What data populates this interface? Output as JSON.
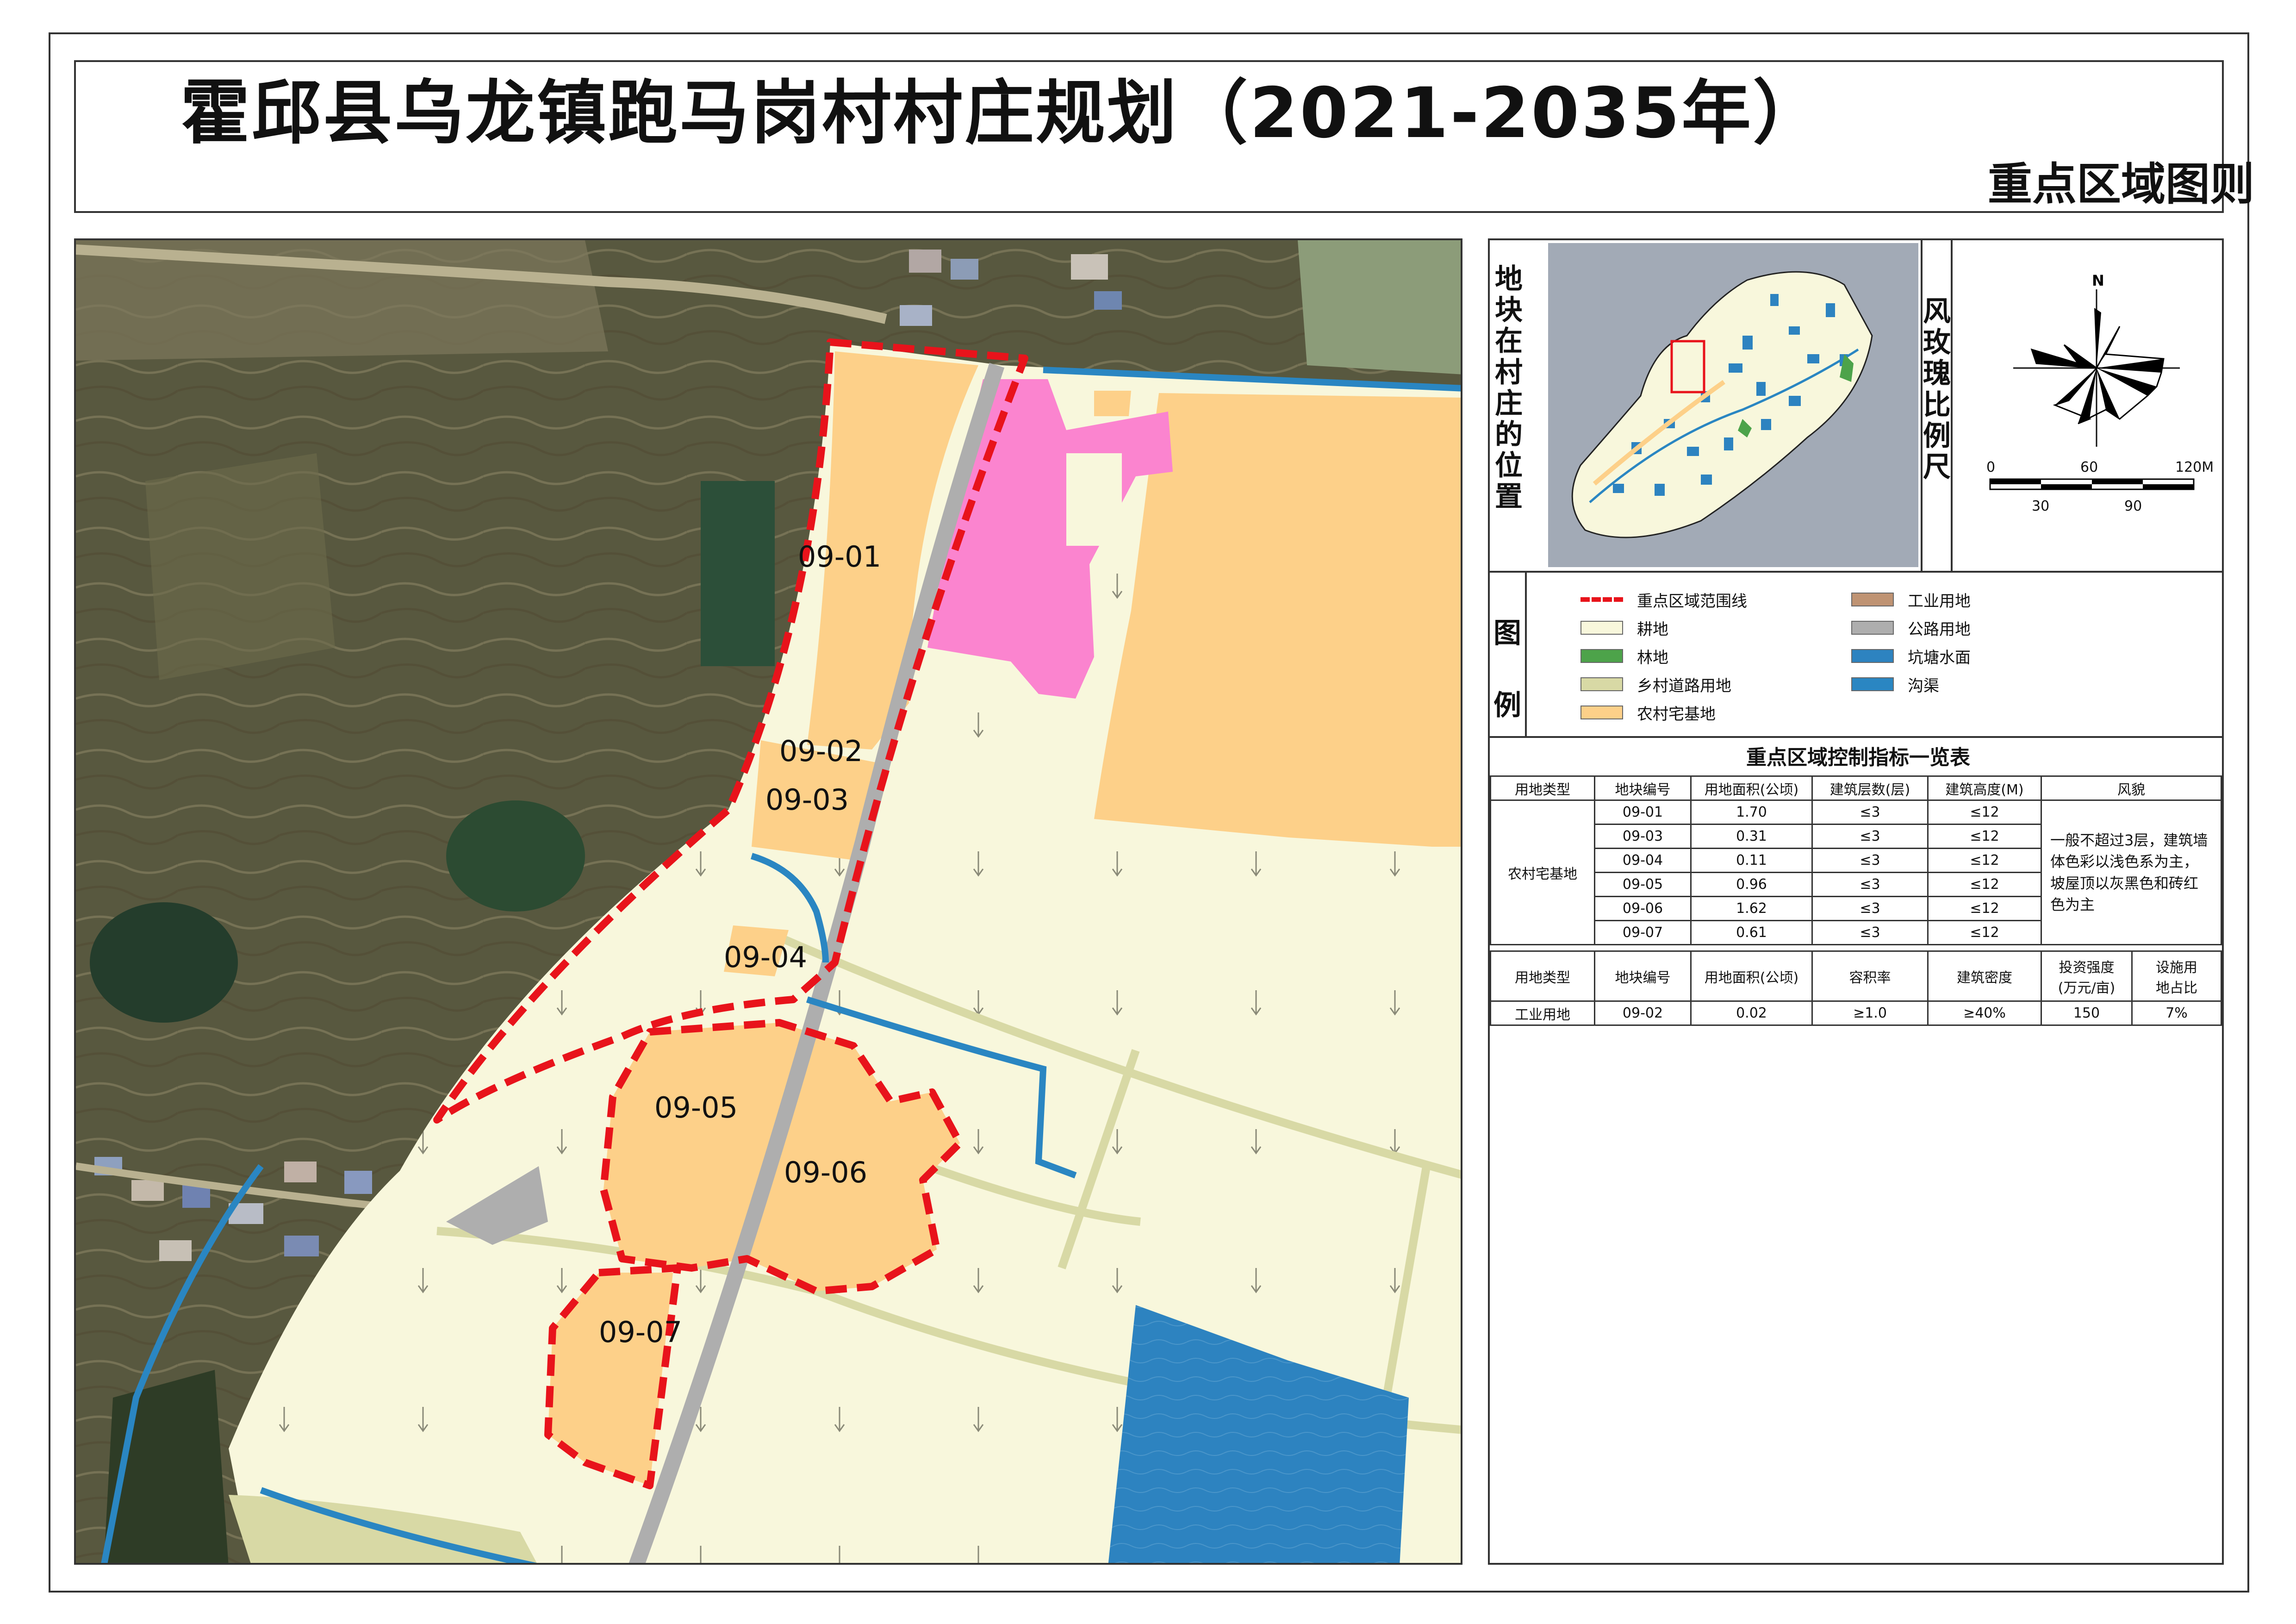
{
  "title": "霍邱县乌龙镇跑马岗村村庄规划（2021-2035年）",
  "subtitle": "重点区域图则",
  "locator": {
    "label": [
      "地",
      "块",
      "在",
      "村",
      "庄",
      "的",
      "位",
      "置"
    ]
  },
  "compass": {
    "label": [
      "风",
      "玫",
      "瑰",
      "比",
      "例",
      "尺"
    ],
    "north": "N",
    "scale_top": [
      "0",
      "60",
      "120M"
    ],
    "scale_bottom": [
      "30",
      "90"
    ]
  },
  "legend": {
    "label": [
      "图",
      "例"
    ],
    "items": [
      {
        "name": "重点区域范围线",
        "color": "#e8131b",
        "kind": "dash"
      },
      {
        "name": "耕地",
        "color": "#f8f7dc",
        "kind": "box"
      },
      {
        "name": "林地",
        "color": "#4da34a",
        "kind": "box"
      },
      {
        "name": "乡村道路用地",
        "color": "#d8d9a5",
        "kind": "box"
      },
      {
        "name": "农村宅基地",
        "color": "#fdd089",
        "kind": "box"
      },
      {
        "name": "工业用地",
        "color": "#bf9373",
        "kind": "box"
      },
      {
        "name": "公路用地",
        "color": "#aeaeae",
        "kind": "box"
      },
      {
        "name": "坑塘水面",
        "color": "#2d83c0",
        "kind": "box"
      },
      {
        "name": "沟渠",
        "color": "#2a86c2",
        "kind": "box"
      }
    ]
  },
  "map": {
    "parcels": [
      "09-01",
      "09-02",
      "09-03",
      "09-04",
      "09-05",
      "09-06",
      "09-07"
    ]
  },
  "table": {
    "title": "重点区域控制指标一览表",
    "headers1": [
      "用地类型",
      "地块编号",
      "用地面积(公顷)",
      "建筑层数(层)",
      "建筑高度(M)",
      "风貌"
    ],
    "group1": "农村宅基地",
    "rows1": [
      [
        "09-01",
        "1.70",
        "≤3",
        "≤12"
      ],
      [
        "09-03",
        "0.31",
        "≤3",
        "≤12"
      ],
      [
        "09-04",
        "0.11",
        "≤3",
        "≤12"
      ],
      [
        "09-05",
        "0.96",
        "≤3",
        "≤12"
      ],
      [
        "09-06",
        "1.62",
        "≤3",
        "≤12"
      ],
      [
        "09-07",
        "0.61",
        "≤3",
        "≤12"
      ]
    ],
    "style_note": "一般不超过3层，建筑墙体色彩以浅色系为主，坡屋顶以灰黑色和砖红色为主",
    "headers2": [
      "用地类型",
      "地块编号",
      "用地面积(公顷)",
      "容积率",
      "建筑密度",
      "投资强度",
      "(万元/亩)",
      "设施用",
      "地占比"
    ],
    "row2": [
      "工业用地",
      "09-02",
      "0.02",
      "≥1.0",
      "≥40%",
      "150",
      "7%"
    ]
  }
}
